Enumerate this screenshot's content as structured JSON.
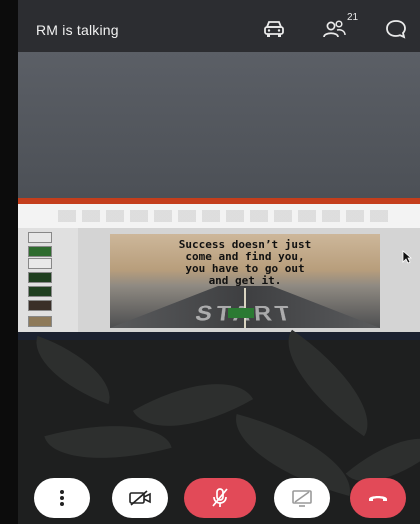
{
  "header": {
    "status_text": "RM is talking",
    "participant_count": "21",
    "icons": [
      "car-icon",
      "participants-icon",
      "chat-icon"
    ]
  },
  "shared_screen": {
    "quote": [
      "Success doesn’t just",
      "come and find you,",
      "you have to go out",
      "and get it."
    ],
    "start_word": "START"
  },
  "controls": {
    "icons": [
      "more-options-icon",
      "camera-off-icon",
      "mic-muted-icon",
      "share-screen-icon",
      "hang-up-icon"
    ],
    "colors": {
      "more": "#ffffff",
      "camera": "#ffffff",
      "mic": "#e24a58",
      "share": "#ffffff",
      "hangup": "#e24a58"
    }
  }
}
